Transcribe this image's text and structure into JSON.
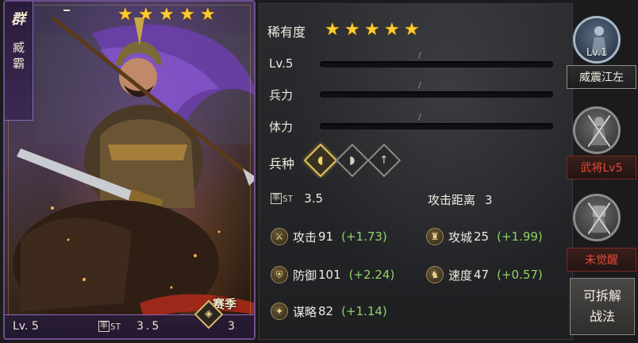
{
  "card": {
    "faction": "群",
    "name": "臧霸",
    "stars": 5,
    "level": "Lv. 5",
    "lead_icon": "率ST",
    "lead_value": "3.5",
    "troop_count": "3",
    "season": "赛季"
  },
  "info": {
    "rarity_label": "稀有度",
    "rarity_stars": 5,
    "level_label": "Lv.5",
    "troops_label": "兵力",
    "stamina_label": "体力",
    "bar_separator": "/",
    "troop_type_label": "兵种",
    "lead_icon": "率ST",
    "lead_value": "3.5",
    "range_label": "攻击距离",
    "range_value": "3",
    "stats": [
      {
        "icon": "sword-icon",
        "label": "攻击",
        "value": "91",
        "bonus": "(+1.73)"
      },
      {
        "icon": "castle-icon",
        "label": "攻城",
        "value": "25",
        "bonus": "(+1.99)"
      },
      {
        "icon": "shield-icon",
        "label": "防御",
        "value": "101",
        "bonus": "(+2.24)"
      },
      {
        "icon": "horse-icon",
        "label": "速度",
        "value": "47",
        "bonus": "(+0.57)"
      },
      {
        "icon": "strategy-icon",
        "label": "谋略",
        "value": "82",
        "bonus": "(+1.14)"
      }
    ]
  },
  "side": {
    "skill1_level": "Lv.1",
    "skill1_name": "威震江左",
    "skill2_name": "武将Lv5",
    "skill3_name": "未觉醒",
    "disassemble_line1": "可拆解",
    "disassemble_line2": "战法"
  },
  "colors": {
    "star": "#ffcc2e",
    "bonus_green": "#8ed36a",
    "locked_red": "#e04a3a",
    "card_border": "#6e4f8f"
  }
}
